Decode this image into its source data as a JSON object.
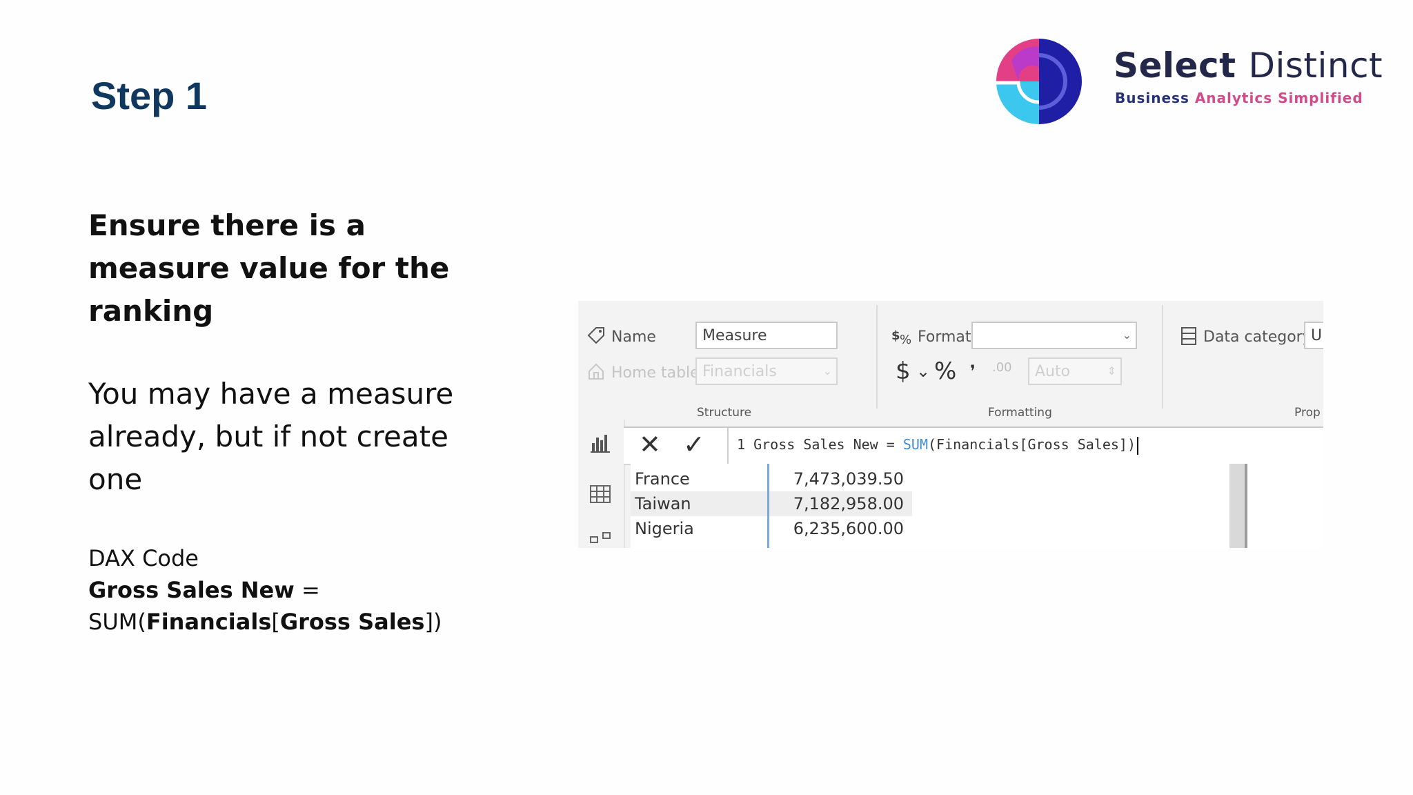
{
  "slide": {
    "title": "Step 1",
    "heading": "Ensure there is a measure value for the ranking",
    "body": "You may have a measure already, but if not create one",
    "code_label": "DAX Code",
    "code_name": "Gross Sales New",
    "code_eq": " =",
    "code_func_open": "SUM(",
    "code_table": "Financials",
    "code_bracket_open": "[",
    "code_column": "Gross Sales",
    "code_close": "])"
  },
  "logo": {
    "name_bold": "Select",
    "name_regular": "Distinct",
    "tagline_part1": "Business",
    "tagline_part2": "Analytics Simplified",
    "colors": {
      "navy": "#2020a0",
      "pink": "#e4407f",
      "cyan": "#39c3ee",
      "magenta": "#c13bcf"
    }
  },
  "ribbon": {
    "structure": {
      "name_label": "Name",
      "name_value": "Measure",
      "home_table_label": "Home table",
      "home_table_value": "Financials",
      "group_title": "Structure"
    },
    "formatting": {
      "format_label": "Format",
      "format_value": "",
      "currency_symbol": "$",
      "dropdown_symbol": "⌄",
      "percent_symbol": "%",
      "comma_symbol": "❜",
      "decimal_symbol": ".00",
      "decimal_places_value": "Auto",
      "group_title": "Formatting"
    },
    "properties": {
      "data_category_label": "Data category",
      "data_category_value": "Ur",
      "group_title": "Prop"
    }
  },
  "formula_bar": {
    "line_number": "1",
    "measure_name": "Gross Sales New",
    "equals": "=",
    "function": "SUM",
    "argument": "(Financials[Gross Sales])"
  },
  "table": {
    "rows": [
      {
        "country": "France",
        "value": "7,473,039.50"
      },
      {
        "country": "Taiwan",
        "value": "7,182,958.00"
      },
      {
        "country": "Nigeria",
        "value": "6,235,600.00"
      }
    ]
  }
}
